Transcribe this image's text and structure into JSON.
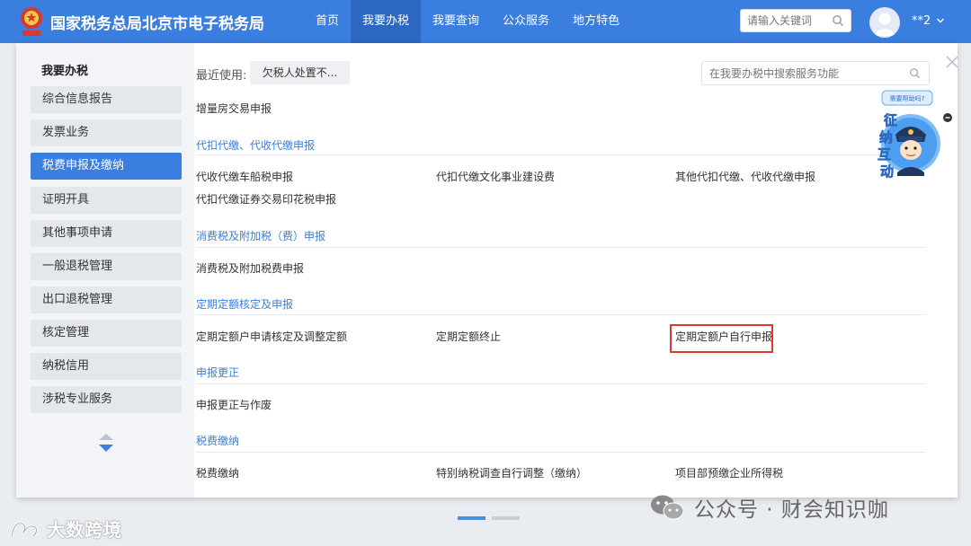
{
  "header": {
    "site_title": "国家税务总局北京市电子税务局",
    "nav": [
      {
        "label": "首页"
      },
      {
        "label": "我要办税",
        "active": true
      },
      {
        "label": "我要查询"
      },
      {
        "label": "公众服务"
      },
      {
        "label": "地方特色"
      }
    ],
    "search_placeholder": "请输入关键词",
    "user_name": "**2",
    "brand_color": "#3a7ee0"
  },
  "sidebar": {
    "title": "我要办税",
    "items": [
      {
        "label": "综合信息报告"
      },
      {
        "label": "发票业务"
      },
      {
        "label": "税费申报及缴纳",
        "active": true
      },
      {
        "label": "证明开具"
      },
      {
        "label": "其他事项申请"
      },
      {
        "label": "一般退税管理"
      },
      {
        "label": "出口退税管理"
      },
      {
        "label": "核定管理"
      },
      {
        "label": "纳税信用"
      },
      {
        "label": "涉税专业服务"
      }
    ]
  },
  "content": {
    "recent_label": "最近使用:",
    "recent_chip": "欠税人处置不...",
    "search_placeholder": "在我要办税中搜索服务功能",
    "top_link": "增量房交易申报",
    "sections": [
      {
        "title": "代扣代缴、代收代缴申报",
        "links": [
          "代收代缴车船税申报",
          "代扣代缴文化事业建设费",
          "其他代扣代缴、代收代缴申报",
          "代扣代缴证券交易印花税申报"
        ]
      },
      {
        "title": "消费税及附加税（费）申报",
        "links": [
          "消费税及附加税费申报"
        ]
      },
      {
        "title": "定期定额核定及申报",
        "links": [
          "定期定额户申请核定及调整定额",
          "定期定额终止",
          "定期定额户自行申报"
        ],
        "highlighted": "定期定额户自行申报"
      },
      {
        "title": "申报更正",
        "links": [
          "申报更正与作废"
        ]
      },
      {
        "title": "税费缴纳",
        "links": [
          "税费缴纳",
          "特别纳税调查自行调整（缴纳）",
          "项目部预缴企业所得税"
        ]
      }
    ],
    "highlight_color": "#e03a2f"
  },
  "mascot": {
    "bubble": "需要帮助吗?",
    "chars": [
      "征",
      "纳",
      "互",
      "动"
    ]
  },
  "carousel": {
    "pages": 2,
    "current": 1
  },
  "watermarks": {
    "left": "大数跨境",
    "right": "公众号 · 财会知识咖"
  }
}
